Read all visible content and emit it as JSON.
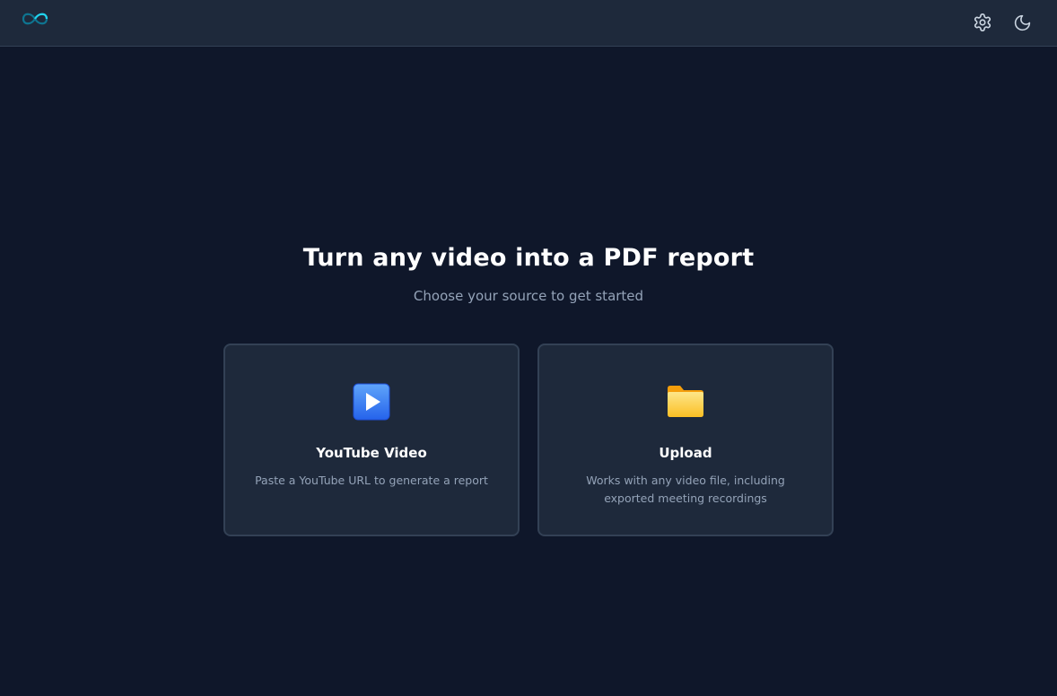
{
  "header": {
    "logo_icon": "infinity-logo-icon",
    "settings_icon": "gear-icon",
    "theme_icon": "moon-icon"
  },
  "hero": {
    "title": "Turn any video into a PDF report",
    "subtitle": "Choose your source to get started"
  },
  "sources": [
    {
      "icon": "play-button-icon",
      "title": "YouTube Video",
      "description": "Paste a YouTube URL to generate a report"
    },
    {
      "icon": "folder-icon",
      "title": "Upload",
      "description": "Works with any video file, including exported meeting recordings"
    }
  ],
  "colors": {
    "background": "#0f172a",
    "surface": "#1e293b",
    "border": "#334155",
    "muted_text": "#94a3b8",
    "accent": "#3b82f6",
    "folder": "#fbbf24"
  }
}
